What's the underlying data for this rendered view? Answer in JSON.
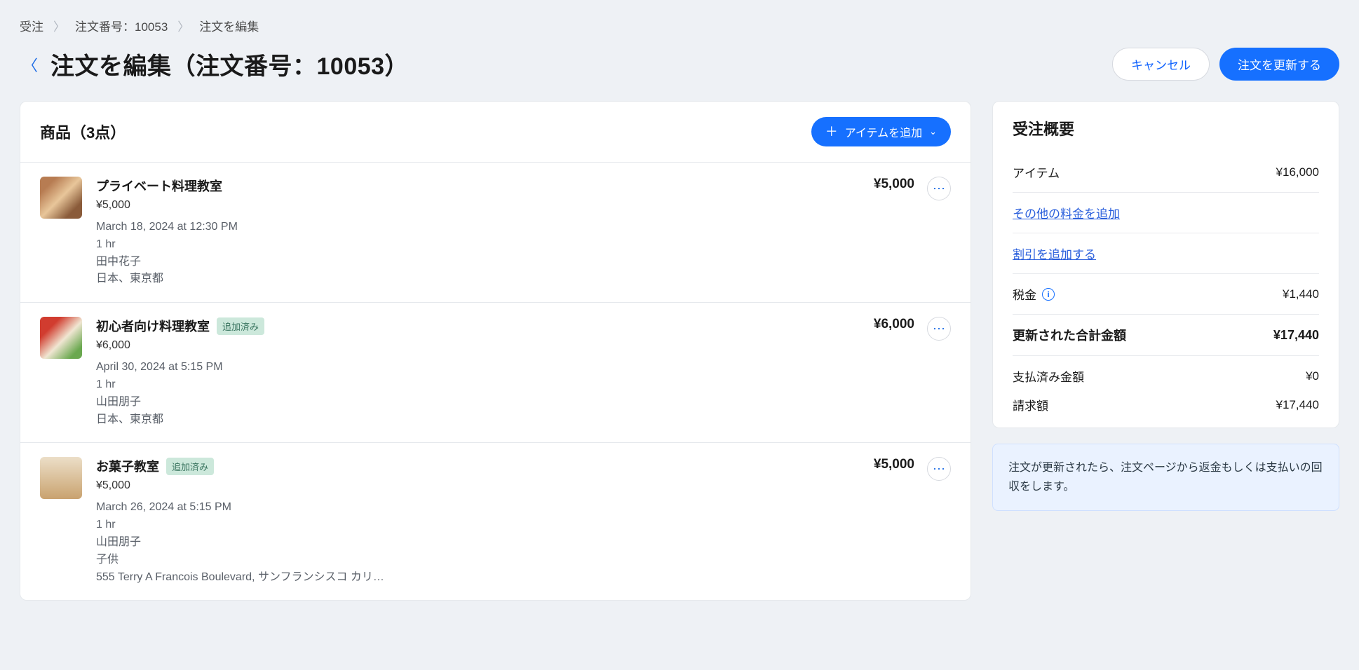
{
  "breadcrumb": {
    "a": "受注",
    "b": "注文番号：10053",
    "c": "注文を編集"
  },
  "title": "注文を編集（注文番号：10053）",
  "buttons": {
    "cancel": "キャンセル",
    "update": "注文を更新する",
    "addItem": "アイテムを追加"
  },
  "products": {
    "title": "商品（3点）",
    "items": [
      {
        "name": "プライベート料理教室",
        "price": "¥5,000",
        "date": "March 18, 2024 at 12:30 PM",
        "duration": "1 hr",
        "customer": "田中花子",
        "location": "日本、東京都",
        "total": "¥5,000",
        "added": ""
      },
      {
        "name": "初心者向け料理教室",
        "price": "¥6,000",
        "date": "April 30, 2024 at 5:15 PM",
        "duration": "1 hr",
        "customer": "山田朋子",
        "location": "日本、東京都",
        "total": "¥6,000",
        "added": "追加済み"
      },
      {
        "name": "お菓子教室",
        "price": "¥5,000",
        "date": "March 26, 2024 at 5:15 PM",
        "duration": "1 hr",
        "customer": "山田朋子",
        "extra": "子供",
        "location": "555 Terry A Francois Boulevard, サンフランシスコ カリ…",
        "total": "¥5,000",
        "added": "追加済み"
      }
    ]
  },
  "summary": {
    "title": "受注概要",
    "items_label": "アイテム",
    "items_value": "¥16,000",
    "add_other": "その他の料金を追加",
    "add_discount": "割引を追加する",
    "tax_label": "税金",
    "tax_value": "¥1,440",
    "updated_total_label": "更新された合計金額",
    "updated_total_value": "¥17,440",
    "paid_label": "支払済み金額",
    "paid_value": "¥0",
    "bill_label": "請求額",
    "bill_value": "¥17,440"
  },
  "notice": "注文が更新されたら、注文ページから返金もしくは支払いの回収をします。"
}
